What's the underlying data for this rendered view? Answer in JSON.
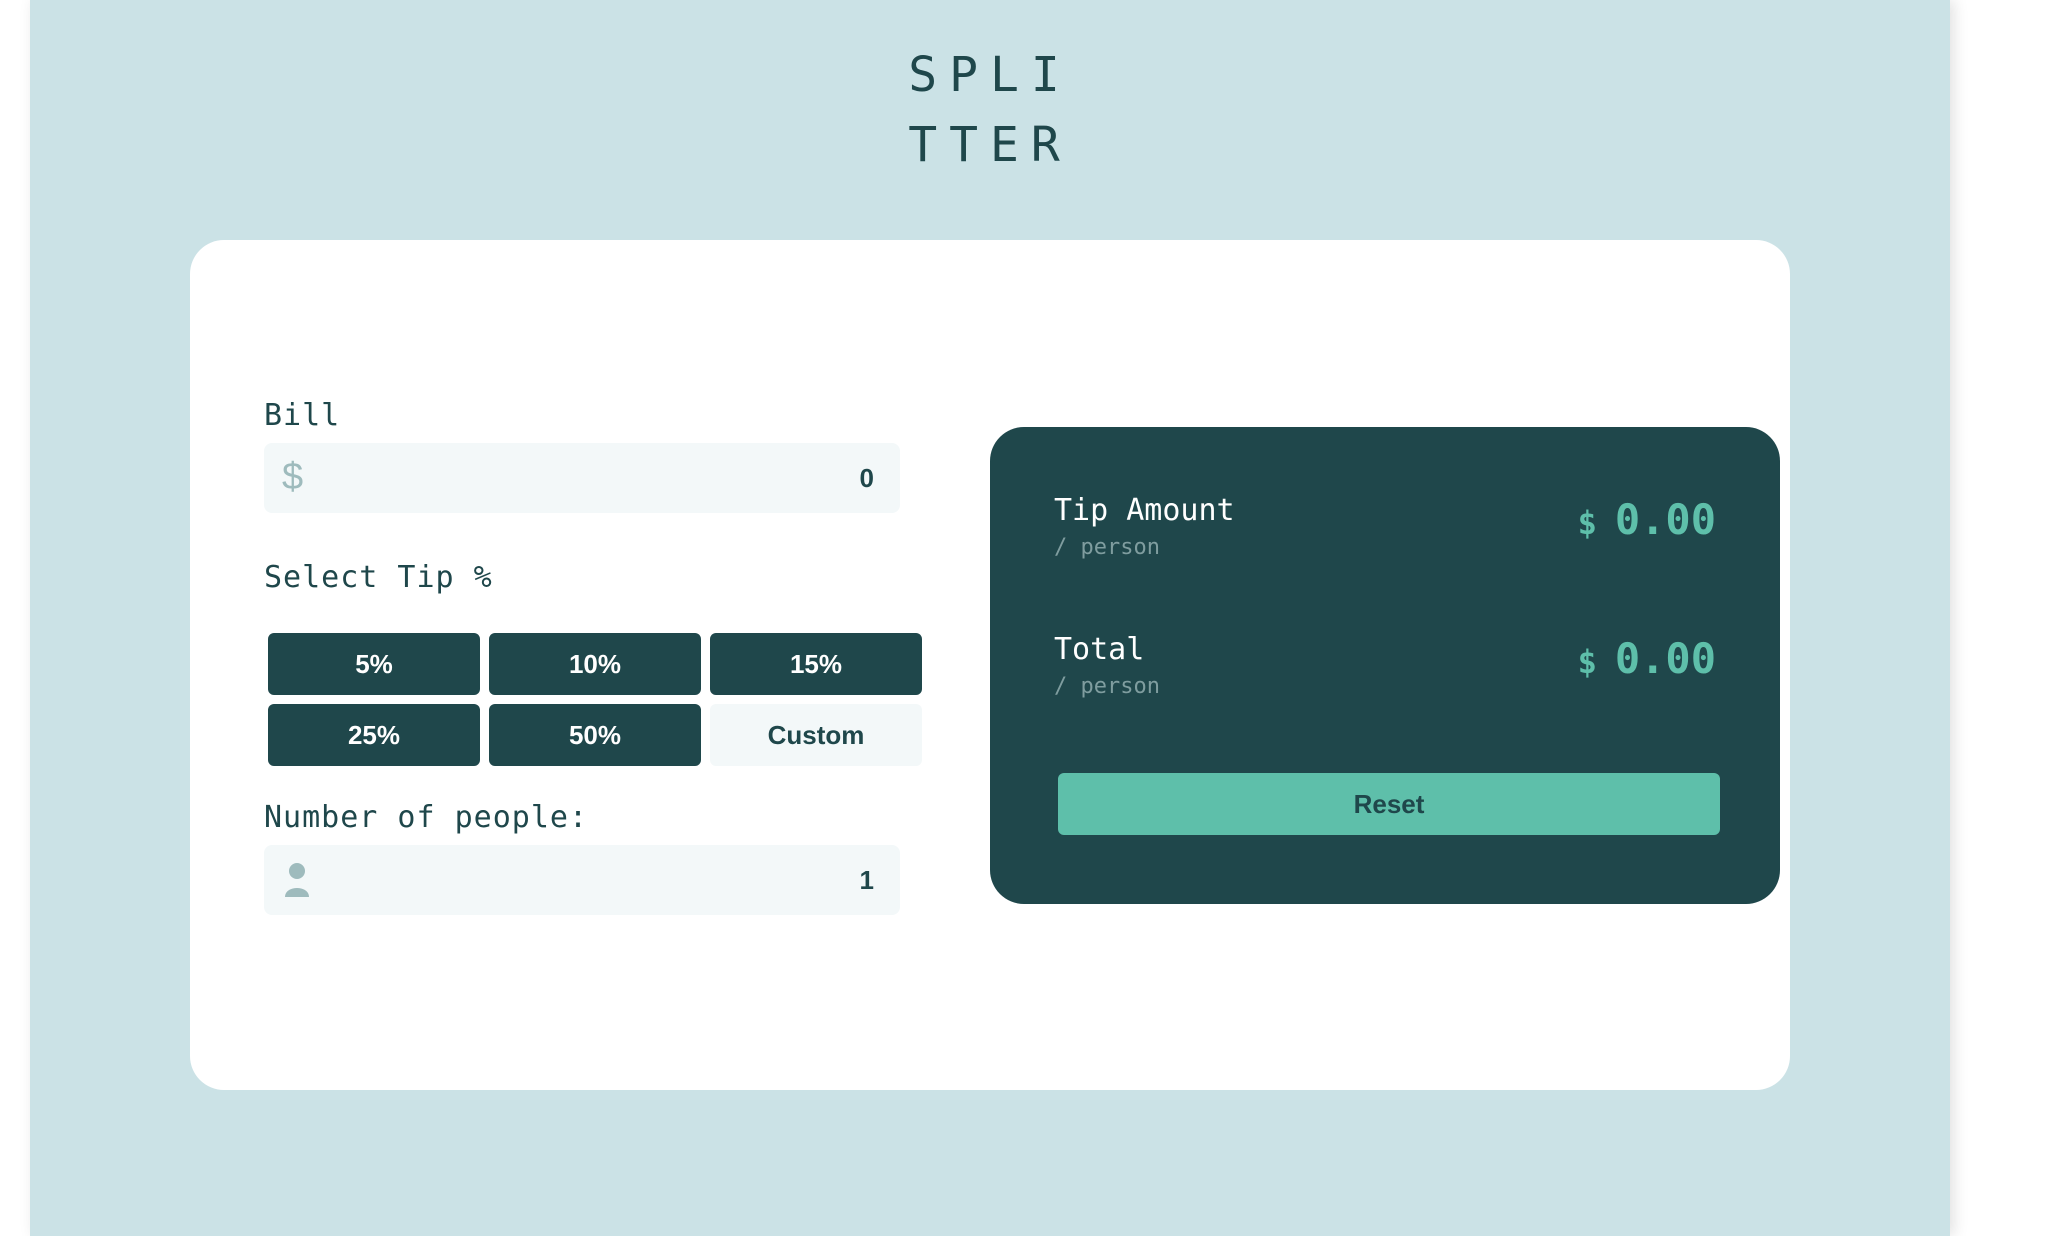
{
  "logo": {
    "line1": "SPLI",
    "line2": "TTER"
  },
  "bill": {
    "label": "Bill",
    "icon": "dollar-icon",
    "icon_glyph": "$",
    "value": "0"
  },
  "tip": {
    "label": "Select Tip %",
    "options": [
      "5%",
      "10%",
      "15%",
      "25%",
      "50%"
    ],
    "custom_label": "Custom"
  },
  "people": {
    "label": "Number of people:",
    "icon": "person-icon",
    "value": "1"
  },
  "results": {
    "tip_amount": {
      "label": "Tip Amount",
      "sub": "/ person",
      "currency": "$",
      "value": "0.00"
    },
    "total": {
      "label": "Total",
      "sub": "/ person",
      "currency": "$",
      "value": "0.00"
    },
    "reset_label": "Reset"
  },
  "colors": {
    "page_bg": "#cbe2e6",
    "dark_teal": "#1f474b",
    "accent": "#5ebfaa",
    "input_bg": "#f3f8f9"
  }
}
